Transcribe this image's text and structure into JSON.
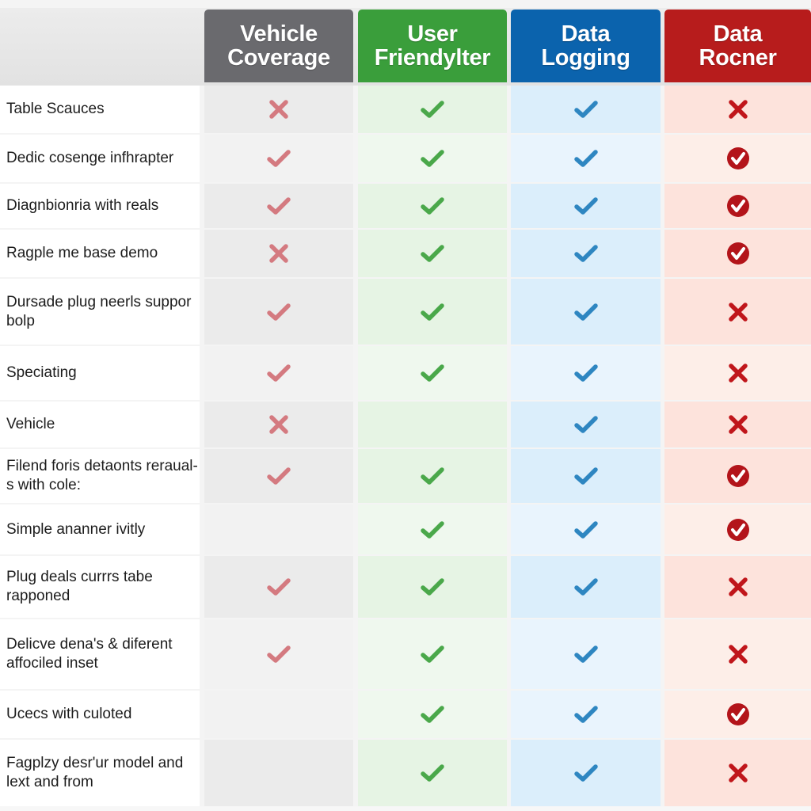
{
  "header": {
    "columns": [
      {
        "line1": "Vehicle",
        "line2": "Coverage",
        "color": "#6a6a6e"
      },
      {
        "line1": "User",
        "line2": "Friendylter",
        "color": "#3a9e3b"
      },
      {
        "line1": "Data",
        "line2": "Logging",
        "color": "#0b63ad"
      },
      {
        "line1": "Data",
        "line2": "Rocner",
        "color": "#b71c1c"
      }
    ]
  },
  "icon_colors": {
    "vehicle_check": "#d47a80",
    "vehicle_cross": "#d47a80",
    "friendly_check": "#4aa84a",
    "logging_check": "#2e86c1",
    "rocner_cross": "#c0161b",
    "rocner_circle_check": "#b3141a"
  },
  "rows": [
    {
      "label": "Table Scauces",
      "values": [
        "cross",
        "check",
        "check",
        "cross"
      ]
    },
    {
      "label": "Dedic cosenge infhrapter",
      "values": [
        "check",
        "check",
        "check",
        "circle-check"
      ]
    },
    {
      "label": "Diagnbionria with reals",
      "values": [
        "check",
        "check",
        "check",
        "circle-check"
      ]
    },
    {
      "label": "Ragple me base demo",
      "values": [
        "cross",
        "check",
        "check",
        "circle-check"
      ]
    },
    {
      "label": "Dursade plug neerls suppor bolp",
      "values": [
        "check",
        "check",
        "check",
        "cross"
      ]
    },
    {
      "label": "Speciating",
      "values": [
        "check",
        "check",
        "check",
        "cross"
      ]
    },
    {
      "label": "Vehicle",
      "values": [
        "cross",
        "none",
        "check",
        "cross"
      ]
    },
    {
      "label": "Filend foris detaonts reraual­s with cole:",
      "values": [
        "check",
        "check",
        "check",
        "circle-check"
      ]
    },
    {
      "label": "Simple ananner ivitly",
      "values": [
        "none",
        "check",
        "check",
        "circle-check"
      ]
    },
    {
      "label": "Plug deals currrs tabe rapponed",
      "values": [
        "check",
        "check",
        "check",
        "cross"
      ]
    },
    {
      "label": "Delicve dena's & diferent affociled inset",
      "values": [
        "check",
        "check",
        "check",
        "cross"
      ]
    },
    {
      "label": "Ucecs with culoted",
      "values": [
        "none",
        "check",
        "check",
        "circle-check"
      ]
    },
    {
      "label": "Fagplzy desr'ur model and lext and from",
      "values": [
        "none",
        "check",
        "check",
        "cross"
      ]
    }
  ]
}
